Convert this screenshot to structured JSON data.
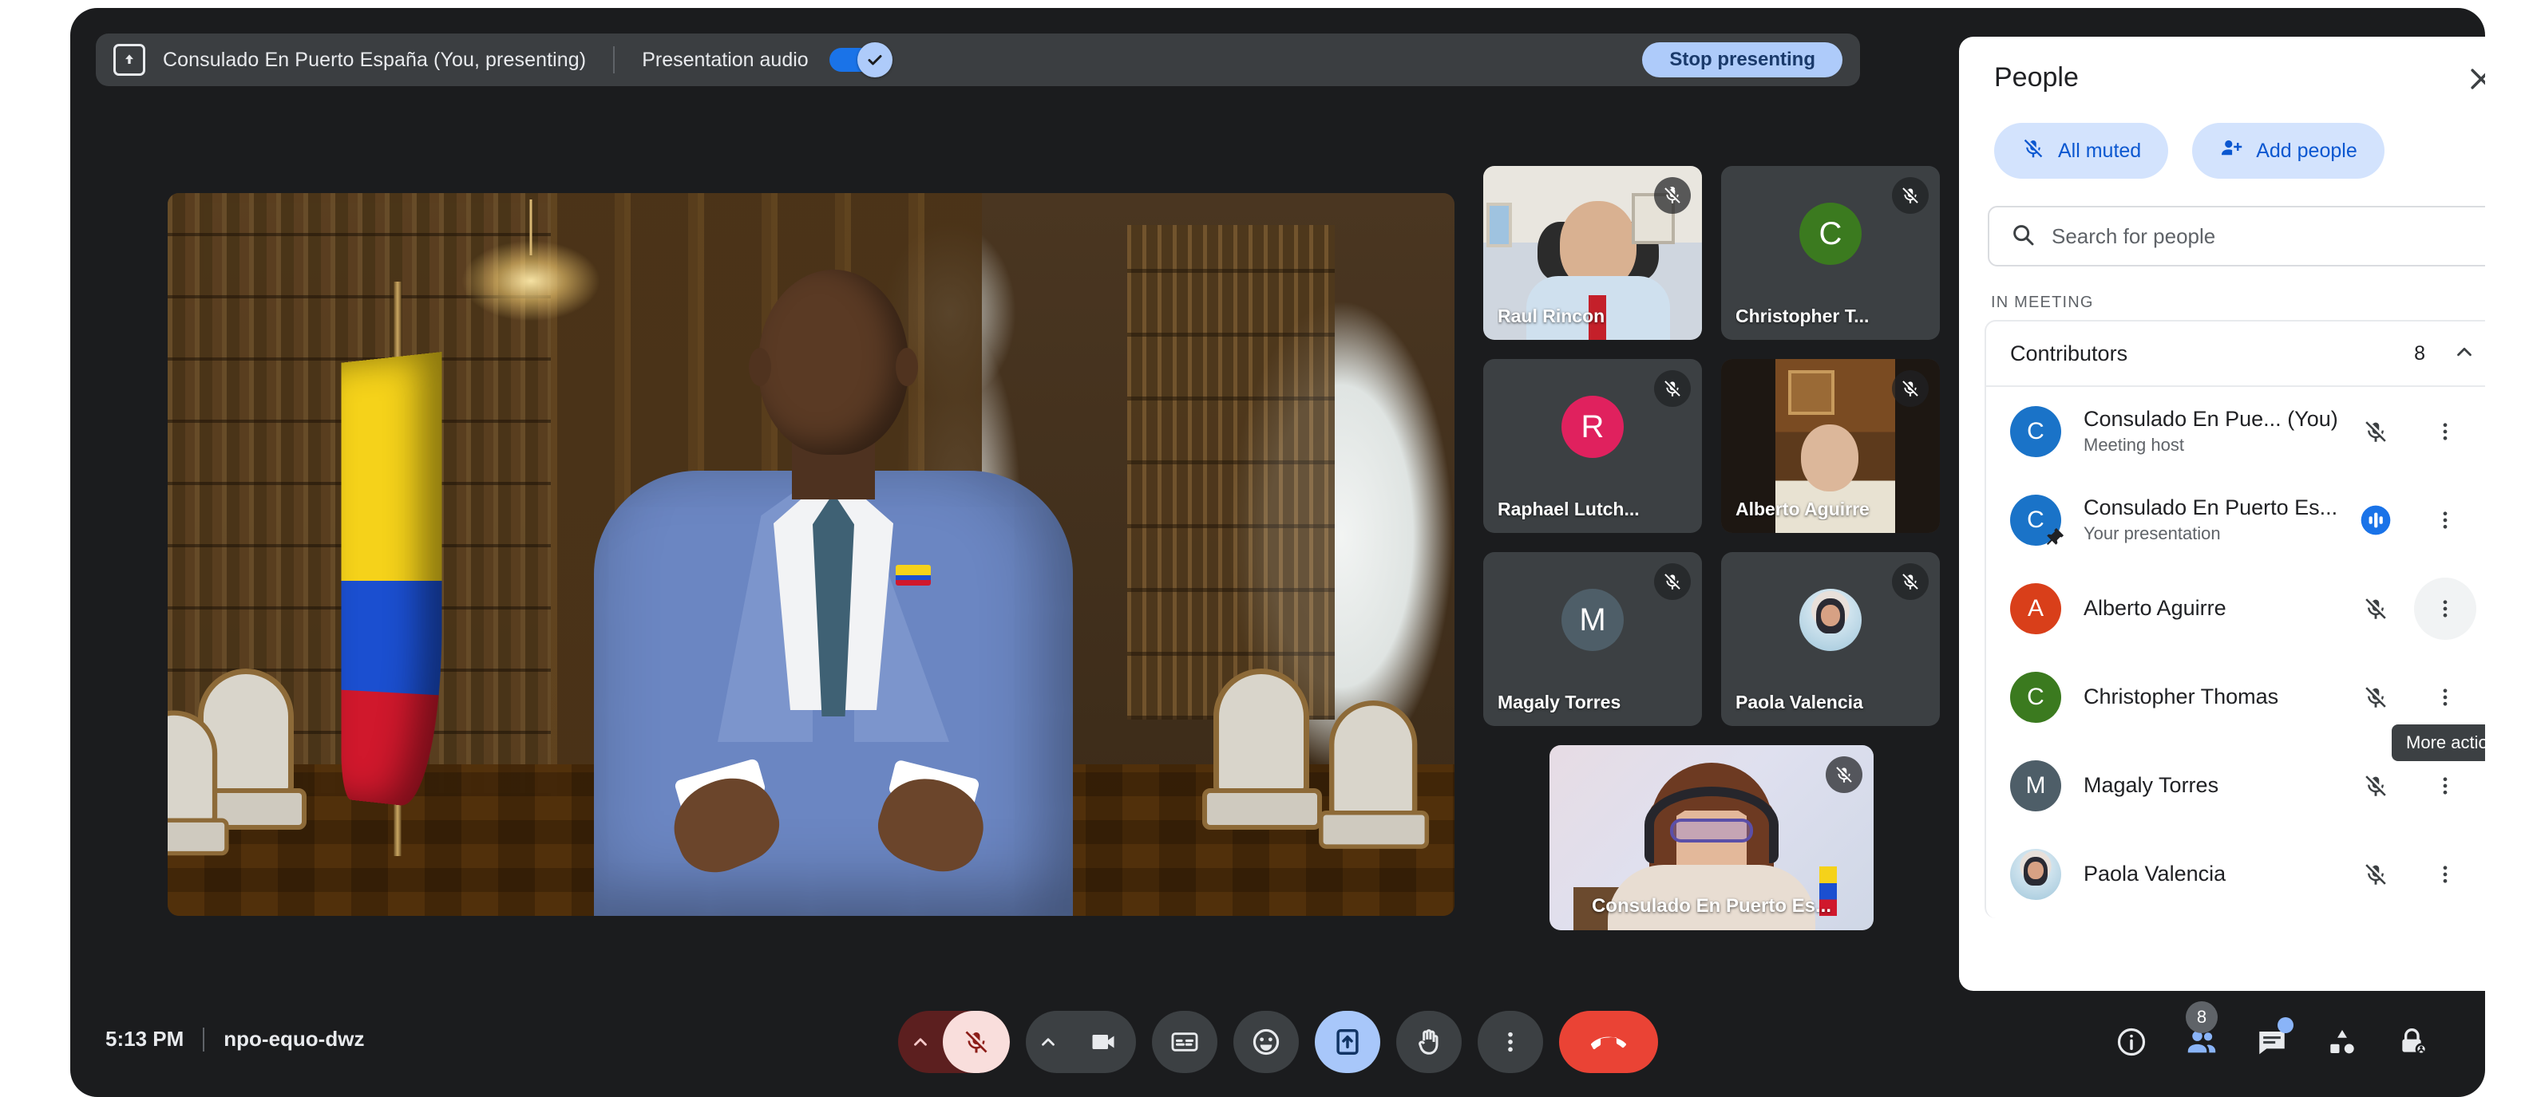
{
  "banner": {
    "present_icon": "present-to-all-icon",
    "title": "Consulado En Puerto España (You, presenting)",
    "audio_label": "Presentation audio",
    "audio_toggle_state": "on",
    "stop_label": "Stop presenting"
  },
  "stage": {
    "description": "Presented video: man in blue suit speaking in a wood-panelled library with a Colombian flag"
  },
  "tiles": [
    {
      "name": "Raul Rincon",
      "kind": "video",
      "muted": true
    },
    {
      "name": "Christopher T...",
      "kind": "initial",
      "initial": "C",
      "color": "#3b7a1f",
      "muted": true
    },
    {
      "name": "Raphael Lutch...",
      "kind": "initial",
      "initial": "R",
      "color": "#e0215e",
      "muted": true
    },
    {
      "name": "Alberto Aguirre",
      "kind": "video",
      "muted": true
    },
    {
      "name": "Magaly Torres",
      "kind": "initial",
      "initial": "M",
      "color": "#4e5e68",
      "muted": true
    },
    {
      "name": "Paola Valencia",
      "kind": "photo",
      "muted": true
    },
    {
      "name": "Consulado En Puerto Es...",
      "kind": "video-self",
      "muted": true
    }
  ],
  "bottom": {
    "time": "5:13 PM",
    "meeting_code": "npo-equo-dwz",
    "controls": [
      {
        "name": "mic-options-chevron",
        "icon": "chevron-up-icon"
      },
      {
        "name": "microphone-off-button",
        "icon": "mic-off-icon",
        "state": "muted"
      },
      {
        "name": "camera-options-chevron",
        "icon": "chevron-up-icon"
      },
      {
        "name": "camera-button",
        "icon": "video-camera-icon"
      },
      {
        "name": "captions-button",
        "icon": "closed-captions-icon"
      },
      {
        "name": "reactions-button",
        "icon": "emoji-smile-icon"
      },
      {
        "name": "present-now-button",
        "icon": "present-to-all-icon",
        "state": "active"
      },
      {
        "name": "raise-hand-button",
        "icon": "raised-hand-icon"
      },
      {
        "name": "more-options-button",
        "icon": "more-vertical-icon"
      },
      {
        "name": "leave-call-button",
        "icon": "end-call-icon"
      }
    ],
    "right_icons": [
      {
        "name": "meeting-details-button",
        "icon": "info-icon"
      },
      {
        "name": "people-button",
        "icon": "people-icon",
        "badge": "8",
        "active": true
      },
      {
        "name": "chat-button",
        "icon": "chat-bubble-icon",
        "dot": true
      },
      {
        "name": "activities-button",
        "icon": "shapes-icon"
      },
      {
        "name": "host-controls-button",
        "icon": "lock-person-icon"
      }
    ]
  },
  "people_panel": {
    "title": "People",
    "close_icon": "close-icon",
    "all_muted_label": "All muted",
    "add_people_label": "Add people",
    "search_placeholder": "Search for people",
    "search_value": "",
    "section_label": "IN MEETING",
    "group": {
      "name": "Contributors",
      "count": "8",
      "expanded": true
    },
    "tooltip": "More actions",
    "rows": [
      {
        "name": "Consulado En Pue...",
        "suffix": "(You)",
        "sub": "Meeting host",
        "avatar_kind": "initial",
        "initial": "C",
        "color": "#1a73c8",
        "status": "mic-off",
        "pin": false
      },
      {
        "name": "Consulado En Puerto Es...",
        "suffix": "",
        "sub": "Your presentation",
        "avatar_kind": "initial",
        "initial": "C",
        "color": "#1a73c8",
        "status": "presenting-audio",
        "pin": true
      },
      {
        "name": "Alberto Aguirre",
        "suffix": "",
        "sub": "",
        "avatar_kind": "initial",
        "initial": "A",
        "color": "#d93f1a",
        "status": "mic-off",
        "pin": false
      },
      {
        "name": "Christopher Thomas",
        "suffix": "",
        "sub": "",
        "avatar_kind": "initial",
        "initial": "C",
        "color": "#3b7a1f",
        "status": "mic-off",
        "pin": false
      },
      {
        "name": "Magaly Torres",
        "suffix": "",
        "sub": "",
        "avatar_kind": "initial",
        "initial": "M",
        "color": "#4e5e68",
        "status": "mic-off",
        "pin": false
      },
      {
        "name": "Paola Valencia",
        "suffix": "",
        "sub": "",
        "avatar_kind": "photo",
        "initial": "P",
        "color": "#9fc6da",
        "status": "mic-off",
        "pin": false
      }
    ]
  },
  "colors": {
    "accent_blue": "#1a73e8",
    "chip_blue": "#d3e3fd",
    "chip_blue_text": "#0b57d0",
    "present_active": "#a8c7fa",
    "leave_red": "#ea4335",
    "mic_red_bg": "#f9dedc",
    "mic_red_fg": "#8c1d18",
    "panel_bg": "#ffffff",
    "window_bg": "#1b1c1e",
    "tile_bg": "#3c4043"
  }
}
